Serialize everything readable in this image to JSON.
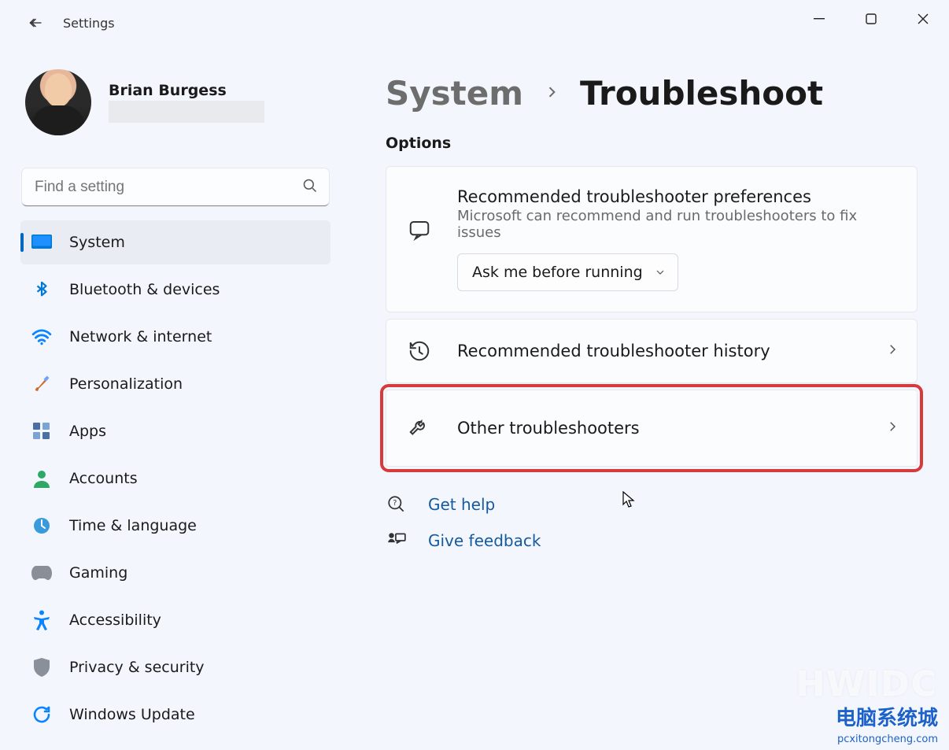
{
  "window": {
    "app_title": "Settings"
  },
  "user": {
    "display_name": "Brian Burgess"
  },
  "search": {
    "placeholder": "Find a setting"
  },
  "nav": {
    "items": [
      {
        "id": "system",
        "label": "System"
      },
      {
        "id": "bluetooth",
        "label": "Bluetooth & devices"
      },
      {
        "id": "network",
        "label": "Network & internet"
      },
      {
        "id": "personalization",
        "label": "Personalization"
      },
      {
        "id": "apps",
        "label": "Apps"
      },
      {
        "id": "accounts",
        "label": "Accounts"
      },
      {
        "id": "time",
        "label": "Time & language"
      },
      {
        "id": "gaming",
        "label": "Gaming"
      },
      {
        "id": "accessibility",
        "label": "Accessibility"
      },
      {
        "id": "privacy",
        "label": "Privacy & security"
      },
      {
        "id": "update",
        "label": "Windows Update"
      }
    ],
    "active_id": "system"
  },
  "breadcrumb": {
    "root": "System",
    "leaf": "Troubleshoot"
  },
  "main": {
    "section_label": "Options",
    "pref_card": {
      "title": "Recommended troubleshooter preferences",
      "subtitle": "Microsoft can recommend and run troubleshooters to fix issues",
      "select_value": "Ask me before running"
    },
    "history_card": {
      "title": "Recommended troubleshooter history"
    },
    "other_card": {
      "title": "Other troubleshooters"
    }
  },
  "help": {
    "get_help": "Get help",
    "give_feedback": "Give feedback"
  },
  "watermark": {
    "line1": "HWIDC",
    "line2": "电脑系统城",
    "line3": "pcxitongcheng.com"
  }
}
